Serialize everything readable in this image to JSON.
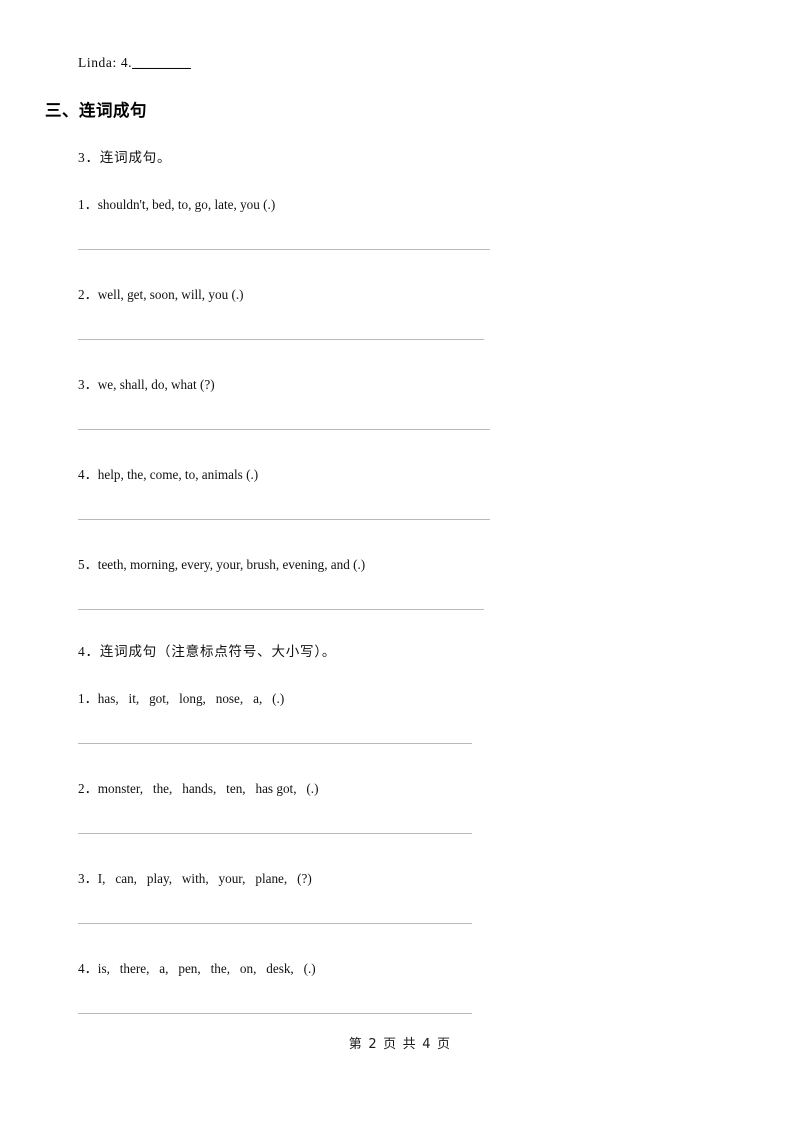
{
  "document": {
    "carry_over_line": {
      "label": "Linda: 4.",
      "blank": "________"
    },
    "section": {
      "number": "三、",
      "title": "连词成句"
    },
    "groups": [
      {
        "title": "3．连词成句。",
        "items": [
          "1．shouldn't, bed, to, go, late, you (.)",
          "2．well, get, soon, will, you (.)",
          "3．we, shall, do, what (?)",
          "4．help, the, come, to, animals (.)",
          "5．teeth, morning, every, your, brush, evening, and (.)"
        ]
      },
      {
        "title": "4．连词成句（注意标点符号、大小写）。",
        "items": [
          "1．has,   it,   got,   long,   nose,   a,   (.)",
          "2．monster,   the,   hands,   ten,   has got,   (.)",
          "3．I,   can,   play,   with,   your,   plane,   (?)",
          "4．is,   there,   a,   pen,   the,   on,   desk,   (.)"
        ]
      }
    ],
    "footer": "第 2 页 共 4 页"
  }
}
